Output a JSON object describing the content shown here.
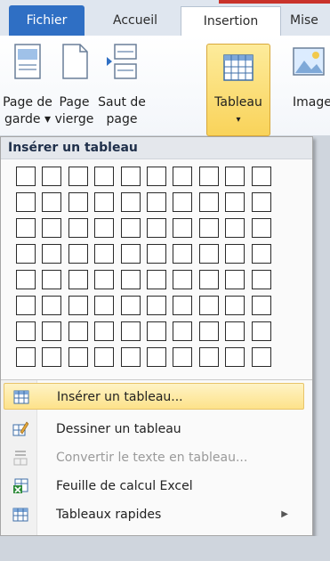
{
  "ribbon": {
    "tabs": [
      "Fichier",
      "Accueil",
      "Insertion",
      "Mise"
    ],
    "buttons": {
      "page_de_garde": [
        "Page de",
        "garde ▾"
      ],
      "page_vierge": [
        "Page",
        "vierge"
      ],
      "saut_de_page": [
        "Saut de",
        "page"
      ],
      "tableau": [
        "Tableau",
        "▾"
      ],
      "image": [
        "Image"
      ]
    }
  },
  "menu": {
    "header": "Insérer un tableau",
    "grid": {
      "columns": 10,
      "rows": 8
    },
    "items": [
      {
        "label": "Insérer un tableau...",
        "icon": "table-icon",
        "highlighted": true,
        "disabled": false
      },
      {
        "label": "Dessiner un tableau",
        "icon": "pencil-table-icon",
        "highlighted": false,
        "disabled": false
      },
      {
        "label": "Convertir le texte en tableau...",
        "icon": "convert-text-icon",
        "highlighted": false,
        "disabled": true
      },
      {
        "label": "Feuille de calcul Excel",
        "icon": "excel-icon",
        "highlighted": false,
        "disabled": false
      },
      {
        "label": "Tableaux rapides",
        "icon": "quick-tables-icon",
        "highlighted": false,
        "disabled": false,
        "submenu": "▶"
      }
    ]
  },
  "colors": {
    "fichier_tab": "#2f6fc4",
    "tableau_button": "#f9d35a",
    "highlight": "#fde28a",
    "excel_green": "#2e8b3a"
  }
}
